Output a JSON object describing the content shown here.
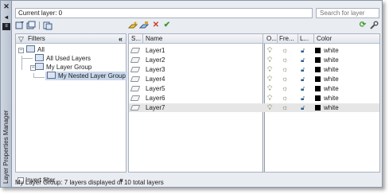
{
  "palette": {
    "vertical_title": "Layer Properties Manager"
  },
  "top": {
    "current_layer_label": "Current layer: 0",
    "search_placeholder": "Search for layer"
  },
  "filters": {
    "header": "Filters",
    "tree": [
      {
        "label": "All"
      },
      {
        "label": "All Used Layers"
      },
      {
        "label": "My Layer Group"
      },
      {
        "label": "My Nested Layer Group"
      }
    ],
    "invert_filter": "Invert filter"
  },
  "columns": {
    "status": "S...",
    "name": "Name",
    "on": "O...",
    "freeze": "Fre...",
    "lock": "L...",
    "color": "Color"
  },
  "layers": [
    {
      "name": "Layer1",
      "color": "white"
    },
    {
      "name": "Layer2",
      "color": "white"
    },
    {
      "name": "Layer3",
      "color": "white"
    },
    {
      "name": "Layer4",
      "color": "white"
    },
    {
      "name": "Layer5",
      "color": "white"
    },
    {
      "name": "Layer6",
      "color": "white"
    },
    {
      "name": "Layer7",
      "color": "white"
    }
  ],
  "status_bar": "My Layer Group: 7 layers displayed of 10 total layers",
  "colors": {
    "swatch": "#000000",
    "ok_check": "#3a9a2a",
    "delete_x": "#d03a2a"
  }
}
